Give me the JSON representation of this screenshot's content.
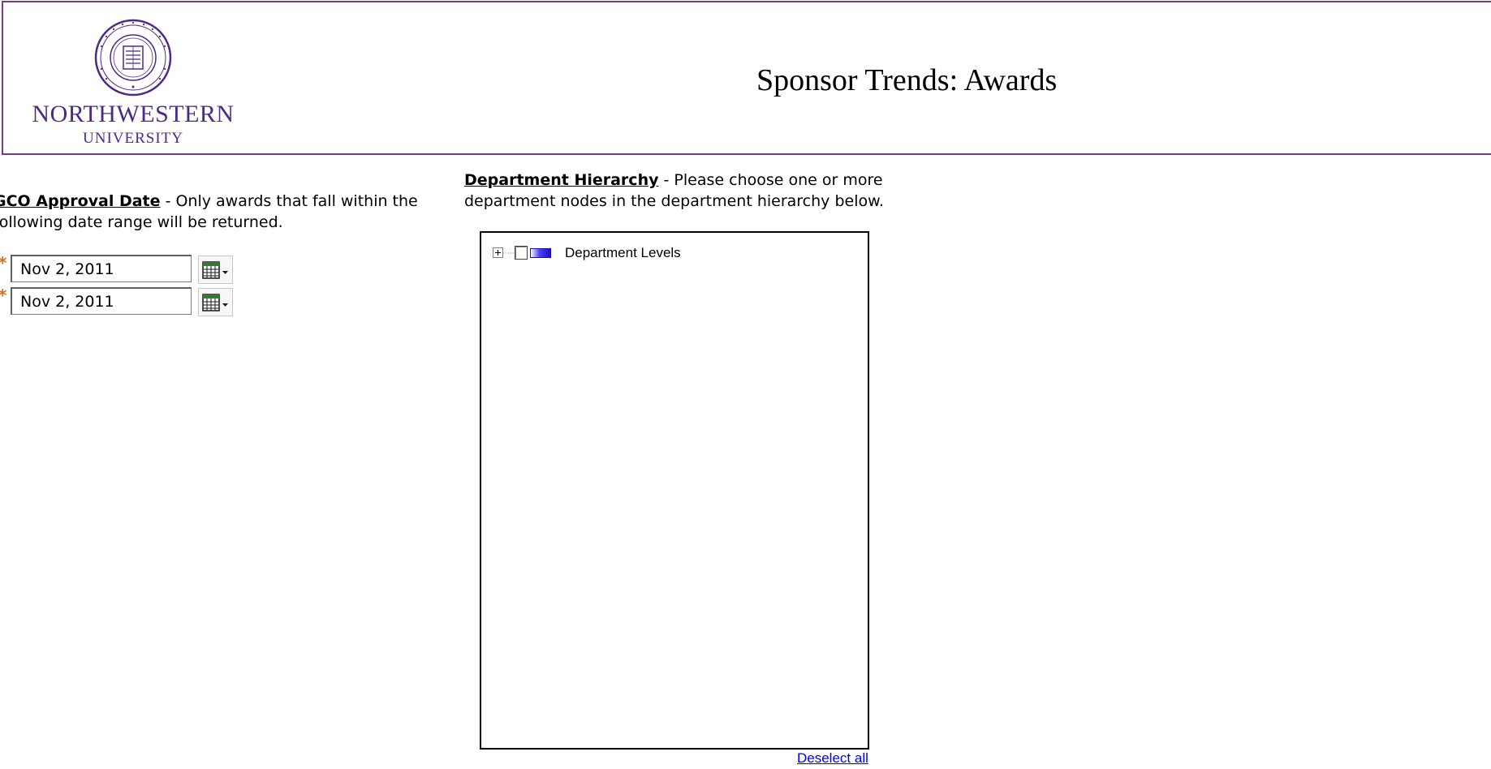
{
  "header": {
    "logo_name": "NORTHWESTERN",
    "logo_sub": "UNIVERSITY",
    "title": "Sponsor Trends: Awards"
  },
  "gco": {
    "label": "GCO Approval Date",
    "description_line1": " - Only awards that fall within the",
    "description_line2": "following date range will be returned.",
    "required_marker": "*",
    "start_date": "Nov 2, 2011",
    "end_date": "Nov 2, 2011",
    "calendar_icon": "calendar-icon"
  },
  "department": {
    "label": "Department Hierarchy",
    "description_line1": " - Please choose one or more",
    "description_line2": "department nodes in the department hierarchy below.",
    "tree": {
      "root_label": "Department Levels",
      "root_checked": false,
      "root_expanded": false
    },
    "deselect_label": "Deselect all"
  },
  "colors": {
    "brand_purple": "#4e2a84",
    "header_border": "#7a3b86",
    "required": "#e06a1b",
    "link": "#0000ee"
  }
}
